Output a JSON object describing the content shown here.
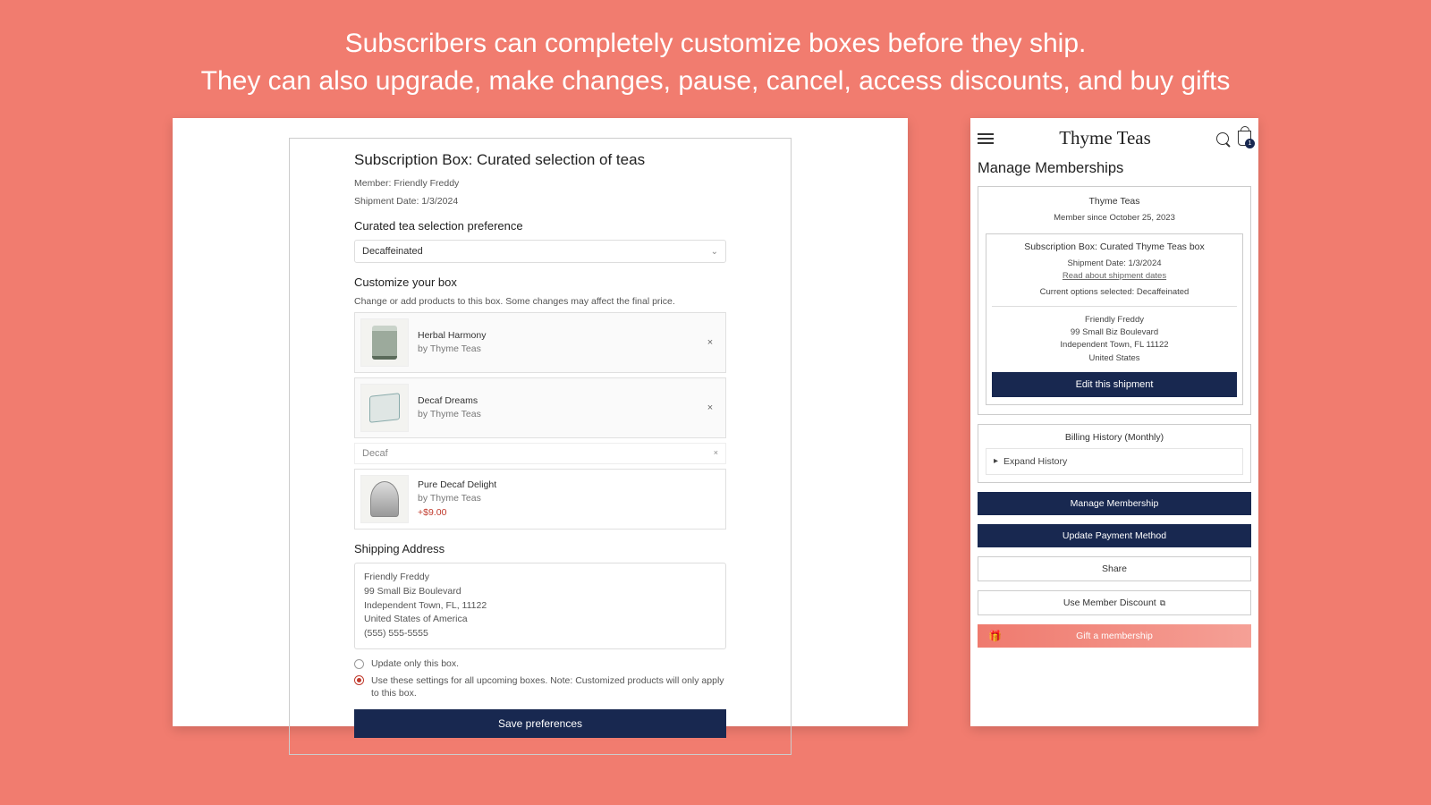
{
  "headline_l1": "Subscribers can completely customize boxes before they ship.",
  "headline_l2": "They can also upgrade, make changes, pause, cancel, access discounts, and buy gifts",
  "left": {
    "title": "Subscription Box: Curated selection of teas",
    "member": "Member: Friendly Freddy",
    "ship_date": "Shipment Date: 1/3/2024",
    "pref_label": "Curated tea selection preference",
    "pref_value": "Decaffeinated",
    "customize_label": "Customize your box",
    "customize_help": "Change or add products to this box. Some changes may affect the final price.",
    "items": [
      {
        "name": "Herbal Harmony",
        "brand": "by Thyme Teas"
      },
      {
        "name": "Decaf Dreams",
        "brand": "by Thyme Teas"
      }
    ],
    "search_value": "Decaf",
    "extra_item": {
      "name": "Pure Decaf Delight",
      "brand": "by Thyme Teas",
      "price": "+$9.00"
    },
    "addr_label": "Shipping Address",
    "addr": {
      "name": "Friendly Freddy",
      "line1": "99 Small Biz Boulevard",
      "line2": "Independent Town, FL, 11122",
      "country": "United States of America",
      "phone": "(555) 555-5555"
    },
    "opt1": "Update only this box.",
    "opt2": "Use these settings for all upcoming boxes. Note: Customized products will only apply to this box.",
    "save_btn": "Save preferences"
  },
  "right": {
    "brand": "Thyme Teas",
    "bag_count": "1",
    "title": "Manage Memberships",
    "card": {
      "company": "Thyme Teas",
      "since": "Member since October 25, 2023",
      "box_title": "Subscription Box: Curated Thyme Teas box",
      "ship_date": "Shipment Date: 1/3/2024",
      "read_link": "Read about shipment dates",
      "options": "Current options selected: Decaffeinated",
      "name": "Friendly Freddy",
      "line1": "99 Small Biz Boulevard",
      "line2": "Independent Town, FL 11122",
      "country": "United States",
      "edit_btn": "Edit this shipment"
    },
    "billing_title": "Billing History (Monthly)",
    "expand": "Expand History",
    "manage_btn": "Manage Membership",
    "payment_btn": "Update Payment Method",
    "share_btn": "Share",
    "discount_btn": "Use Member Discount",
    "gift_btn": "Gift a membership"
  }
}
